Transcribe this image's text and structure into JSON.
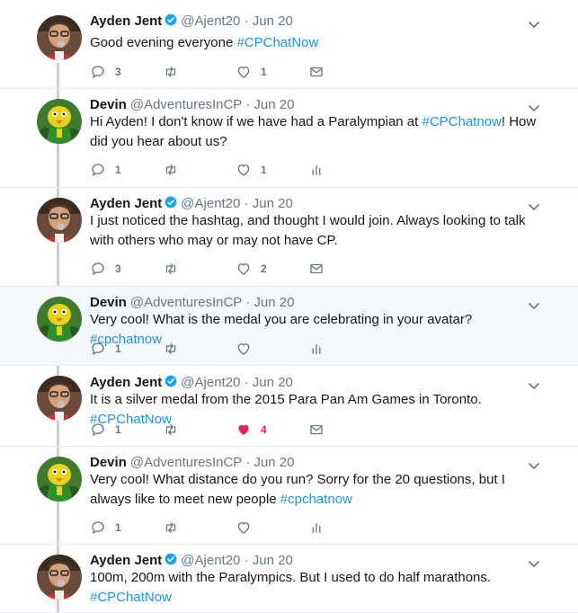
{
  "tweets": [
    {
      "name": "Ayden Jent",
      "verified": true,
      "handle": "@Ajent20",
      "date": "Jun 20",
      "text_parts": [
        {
          "t": "Good evening everyone "
        },
        {
          "t": "#CPChatNow",
          "tag": true
        }
      ],
      "replies": "3",
      "retweets": "",
      "likes": "1",
      "liked": false,
      "extra": "mail",
      "highlight": false,
      "avatar": "ayden"
    },
    {
      "name": "Devin",
      "verified": false,
      "handle": "@AdventuresInCP",
      "date": "Jun 20",
      "text_parts": [
        {
          "t": "Hi Ayden! I don't know if we have had a Paralympian at "
        },
        {
          "t": "#CPChatnow",
          "tag": true
        },
        {
          "t": "! How did you hear about us?"
        }
      ],
      "replies": "1",
      "retweets": "",
      "likes": "1",
      "liked": false,
      "extra": "analytics",
      "highlight": false,
      "avatar": "devin"
    },
    {
      "name": "Ayden Jent",
      "verified": true,
      "handle": "@Ajent20",
      "date": "Jun 20",
      "text_parts": [
        {
          "t": "I just noticed the hashtag, and thought I would join. Always looking to talk with others who may or may not have CP."
        }
      ],
      "replies": "3",
      "retweets": "",
      "likes": "2",
      "liked": false,
      "extra": "mail",
      "highlight": false,
      "avatar": "ayden"
    },
    {
      "name": "Devin",
      "verified": false,
      "handle": "@AdventuresInCP",
      "date": "Jun 20",
      "text_parts": [
        {
          "t": "Very cool! What is the medal you are celebrating in your avatar? "
        },
        {
          "t": "#cpchatnow",
          "tag": true
        }
      ],
      "replies": "1",
      "retweets": "",
      "likes": "",
      "liked": false,
      "extra": "analytics",
      "highlight": true,
      "avatar": "devin"
    },
    {
      "name": "Ayden Jent",
      "verified": true,
      "handle": "@Ajent20",
      "date": "Jun 20",
      "text_parts": [
        {
          "t": "It is a silver medal from the 2015 Para Pan Am Games in Toronto. "
        },
        {
          "t": "#CPChatNow",
          "tag": true
        }
      ],
      "replies": "1",
      "retweets": "",
      "likes": "4",
      "liked": true,
      "extra": "mail",
      "highlight": false,
      "avatar": "ayden"
    },
    {
      "name": "Devin",
      "verified": false,
      "handle": "@AdventuresInCP",
      "date": "Jun 20",
      "text_parts": [
        {
          "t": "Very cool! What distance do you run? Sorry for the 20 questions, but I always like to meet new people "
        },
        {
          "t": "#cpchatnow",
          "tag": true
        }
      ],
      "replies": "1",
      "retweets": "",
      "likes": "",
      "liked": false,
      "extra": "analytics",
      "highlight": false,
      "avatar": "devin"
    },
    {
      "name": "Ayden Jent",
      "verified": true,
      "handle": "@Ajent20",
      "date": "Jun 20",
      "text_parts": [
        {
          "t": "100m, 200m with the Paralympics. But I used to do half marathons. "
        },
        {
          "t": "#CPChatNow",
          "tag": true
        }
      ],
      "replies": "",
      "retweets": "",
      "likes": "",
      "liked": false,
      "extra": "",
      "highlight": false,
      "avatar": "ayden"
    }
  ],
  "colors": {
    "link": "#1b95e0",
    "verified": "#1da1f2",
    "liked": "#e0245e",
    "muted": "#657786",
    "connector": "#c4cfd6"
  },
  "icons": {
    "reply": "reply-icon",
    "retweet": "retweet-icon",
    "like": "heart-icon",
    "mail": "direct-message-icon",
    "analytics": "analytics-icon",
    "caret": "chevron-down-icon",
    "verified": "verified-badge-icon"
  }
}
